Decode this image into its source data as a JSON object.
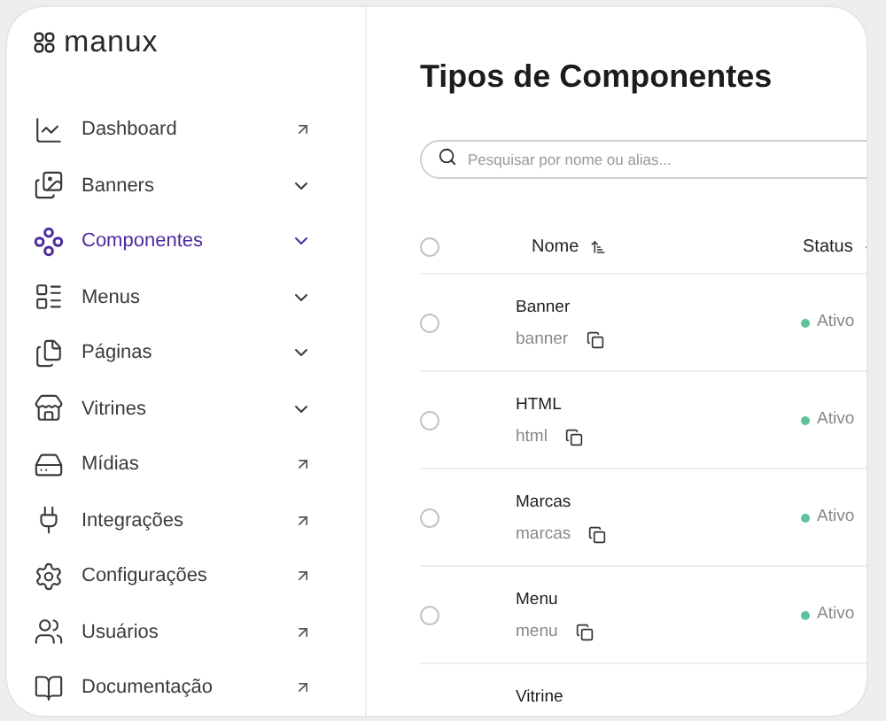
{
  "logo": {
    "text": "manux"
  },
  "sidebar": {
    "items": [
      {
        "label": "Dashboard",
        "kind": "link",
        "selected": false
      },
      {
        "label": "Banners",
        "kind": "expand",
        "selected": false
      },
      {
        "label": "Componentes",
        "kind": "expand",
        "selected": true
      },
      {
        "label": "Menus",
        "kind": "expand",
        "selected": false
      },
      {
        "label": "Páginas",
        "kind": "expand",
        "selected": false
      },
      {
        "label": "Vitrines",
        "kind": "expand",
        "selected": false
      },
      {
        "label": "Mídias",
        "kind": "link",
        "selected": false
      },
      {
        "label": "Integrações",
        "kind": "link",
        "selected": false
      },
      {
        "label": "Configurações",
        "kind": "link",
        "selected": false
      },
      {
        "label": "Usuários",
        "kind": "link",
        "selected": false
      },
      {
        "label": "Documentação",
        "kind": "link",
        "selected": false
      }
    ]
  },
  "page": {
    "title": "Tipos de Componentes"
  },
  "search": {
    "placeholder": "Pesquisar por nome ou alias..."
  },
  "table": {
    "select_all_checked": false,
    "columns": [
      "Nome",
      "Status"
    ],
    "rows": [
      {
        "name": "Banner",
        "alias": "banner",
        "status": "Ativo",
        "checked": false
      },
      {
        "name": "HTML",
        "alias": "html",
        "status": "Ativo",
        "checked": false
      },
      {
        "name": "Marcas",
        "alias": "marcas",
        "status": "Ativo",
        "checked": false
      },
      {
        "name": "Menu",
        "alias": "menu",
        "status": "Ativo",
        "checked": false
      },
      {
        "name": "Vitrine"
      }
    ]
  }
}
